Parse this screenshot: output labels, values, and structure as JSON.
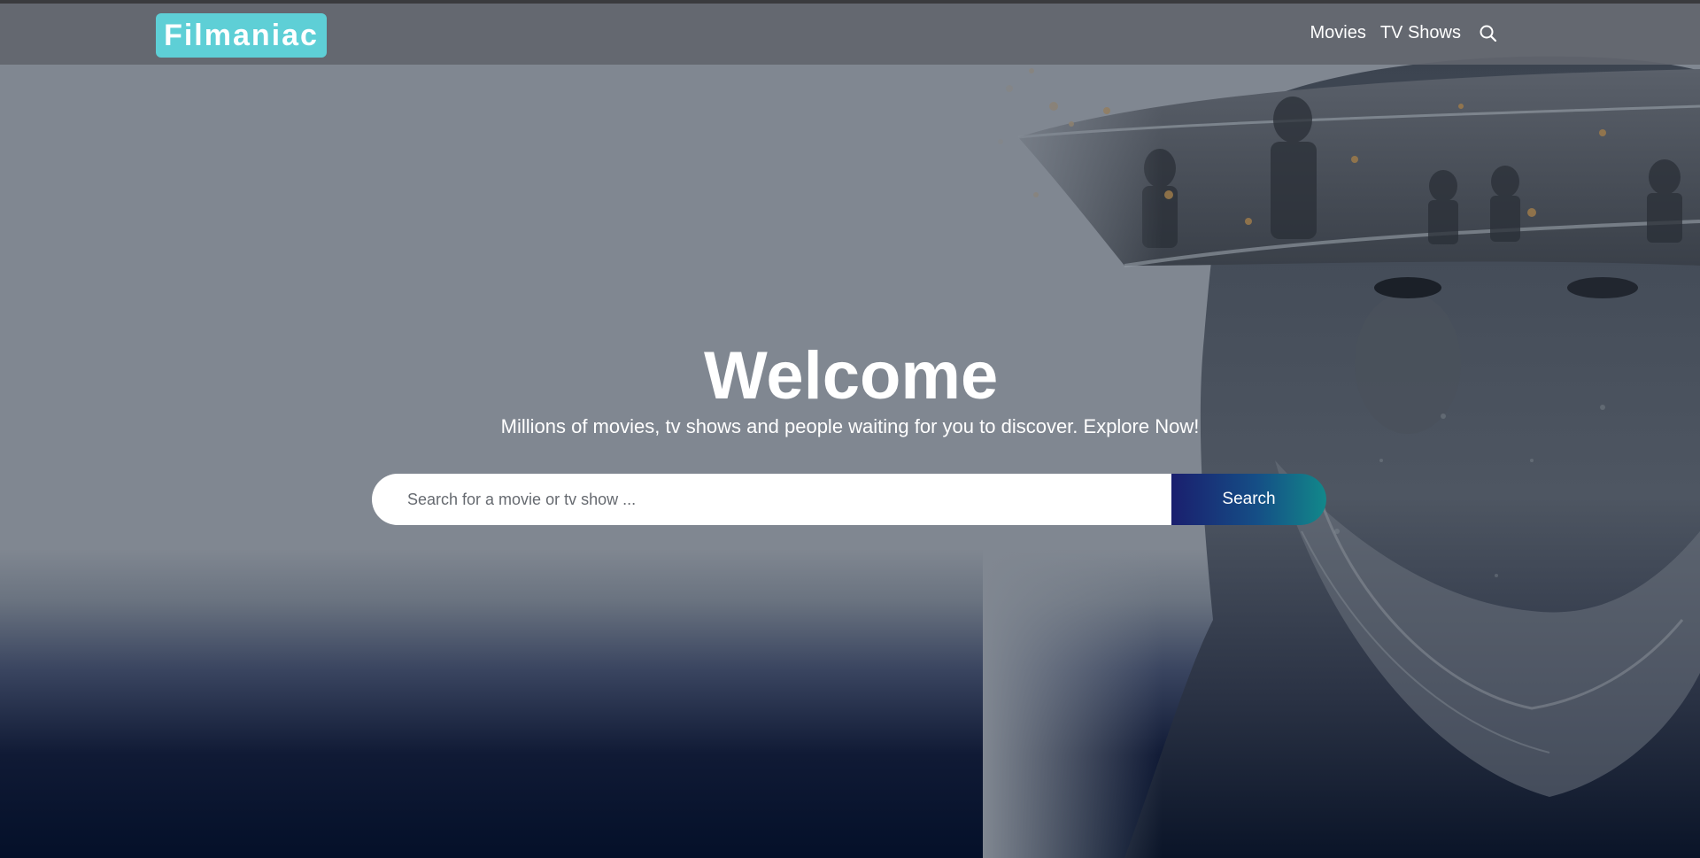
{
  "header": {
    "logo_text": "Filmaniac",
    "nav": {
      "movies_label": "Movies",
      "tv_shows_label": "TV Shows",
      "search_icon": "search-icon"
    }
  },
  "hero": {
    "title": "Welcome",
    "subtitle": "Millions of movies, tv shows and people waiting for you to discover. Explore Now!",
    "search": {
      "placeholder": "Search for a movie or tv show ...",
      "value": "",
      "button_label": "Search"
    },
    "background_image": "soldier-portrait-artwork"
  },
  "colors": {
    "logo_bg": "#5ecfd6",
    "header_bg": "#62656e",
    "hero_overlay": "#808791",
    "hero_bottom": "#041029",
    "button_gradient_start": "#1a1f6e",
    "button_gradient_end": "#12888a"
  }
}
